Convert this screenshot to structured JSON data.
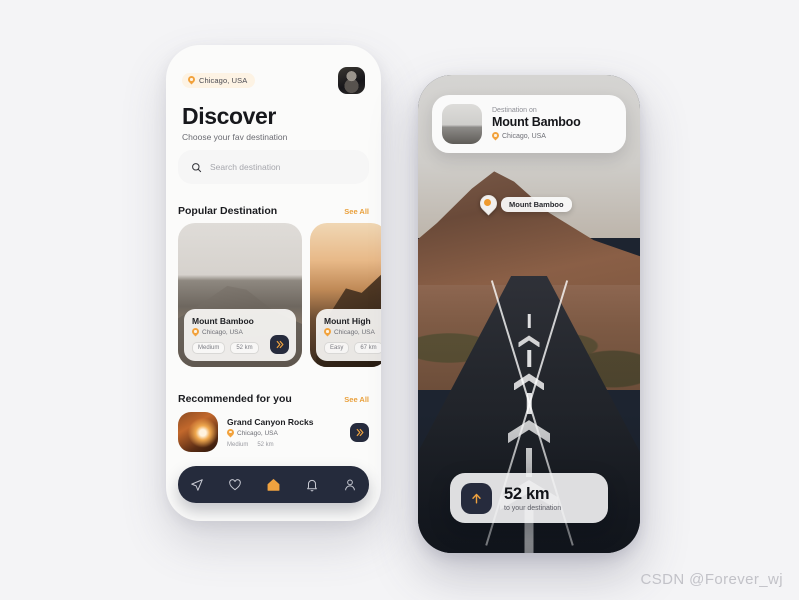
{
  "app": {
    "background_color": "#f4f4f6",
    "accent_color": "#f0a23f",
    "dark_color": "#262b3d"
  },
  "left_phone": {
    "location_pill": {
      "label": "Chicago, USA",
      "icon": "map-pin-icon"
    },
    "avatar": {
      "icon": "avatar-image"
    },
    "title": "Discover",
    "subtitle": "Choose your fav destination",
    "search": {
      "placeholder": "Search destination",
      "icon": "search-icon"
    },
    "popular": {
      "title": "Popular Destination",
      "see_all": "See All",
      "cards": [
        {
          "name": "Mount Bamboo",
          "location": "Chicago, USA",
          "difficulty": "Medium",
          "distance": "52 km",
          "go_icon": "double-chevron-right-icon"
        },
        {
          "name": "Mount High",
          "location": "Chicago, USA",
          "difficulty": "Easy",
          "distance": "67 km"
        }
      ]
    },
    "recommended": {
      "title": "Recommended for you",
      "see_all": "See All",
      "items": [
        {
          "name": "Grand Canyon Rocks",
          "location": "Chicago, USA",
          "difficulty": "Medium",
          "distance": "52 km",
          "go_icon": "double-chevron-right-icon"
        }
      ]
    },
    "nav": [
      {
        "name": "send-icon",
        "active": false
      },
      {
        "name": "heart-icon",
        "active": false
      },
      {
        "name": "home-icon",
        "active": true
      },
      {
        "name": "bell-icon",
        "active": false
      },
      {
        "name": "profile-icon",
        "active": false
      }
    ]
  },
  "right_phone": {
    "destination_card": {
      "label": "Destination on",
      "name": "Mount Bamboo",
      "location": "Chicago, USA"
    },
    "map_marker": {
      "label": "Mount Bamboo",
      "icon": "map-pin-icon"
    },
    "distance_card": {
      "icon": "arrow-up-icon",
      "value": "52 km",
      "caption": "to your destination"
    }
  },
  "watermark": "CSDN @Forever_wj"
}
